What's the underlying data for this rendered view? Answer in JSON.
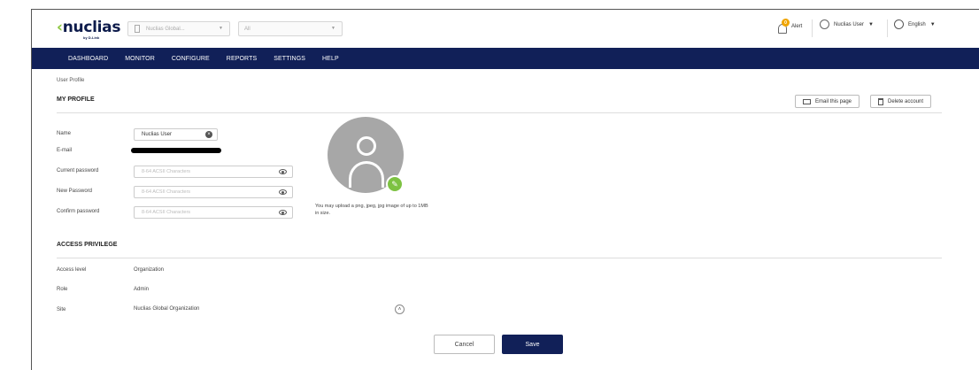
{
  "header": {
    "logo_text": "nuclias",
    "logo_sub": "by D-Link",
    "org_select": "Nuclias Global...",
    "site_select": "All",
    "alert_count": "0",
    "alert_label": "Alert",
    "user_label": "Nuclias User",
    "language": "English"
  },
  "nav": {
    "items": [
      "DASHBOARD",
      "MONITOR",
      "CONFIGURE",
      "REPORTS",
      "SETTINGS",
      "HELP"
    ]
  },
  "breadcrumb": "User Profile",
  "profile": {
    "title": "MY PROFILE",
    "email_page_label": "Email this page",
    "delete_account_label": "Delete account",
    "name_label": "Name",
    "name_value": "Nuclias User",
    "email_label": "E-mail",
    "current_password_label": "Current password",
    "new_password_label": "New Password",
    "confirm_password_label": "Confirm password",
    "password_placeholder": "8-64 ACSII Characters",
    "upload_hint": "You may upload a png, jpeg, jpg image of up to 1MB in size."
  },
  "access": {
    "title": "ACCESS PRIVILEGE",
    "access_level_label": "Access level",
    "access_level_value": "Organization",
    "role_label": "Role",
    "role_value": "Admin",
    "site_label": "Site",
    "site_value": "Nuclias Global Organization"
  },
  "actions": {
    "cancel": "Cancel",
    "save": "Save"
  },
  "colors": {
    "nav_bg": "#112058",
    "accent_green": "#7dc242",
    "alert_badge": "#f0a500"
  }
}
